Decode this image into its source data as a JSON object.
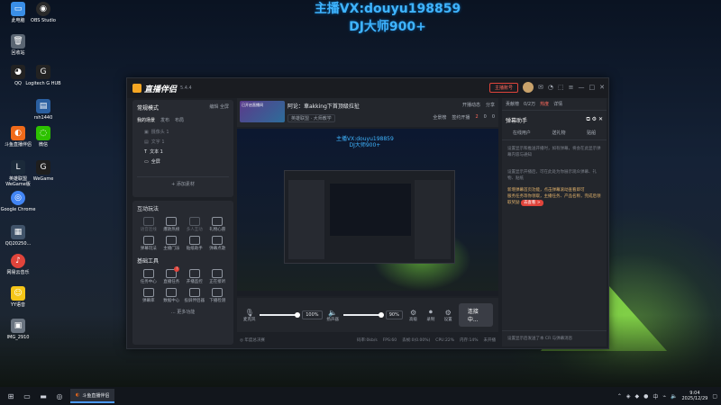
{
  "watermark": {
    "line1": "主播VX:douyu198859",
    "line2": "DJ大师900+"
  },
  "desktop_icons": [
    {
      "label": "此电脑",
      "color": "#3a8ee6"
    },
    {
      "label": "OBS Studio",
      "color": "#2a2a2a"
    },
    {
      "label": "回收站",
      "color": "#5a6572"
    },
    {
      "label": "QQ",
      "color": "#222"
    },
    {
      "label": "Logitech G HUB",
      "color": "#222"
    },
    {
      "label": "rsh1440",
      "color": "#2a5fa0"
    },
    {
      "label": "斗鱼直播伴侣",
      "color": "#f06a1a"
    },
    {
      "label": "微信",
      "color": "#2dc100"
    },
    {
      "label": "英雄联盟 WeGame版",
      "color": "#1b2a3a"
    },
    {
      "label": "WeGame",
      "color": "#1e1e1e"
    },
    {
      "label": "Google Chrome",
      "color": "#4285f4"
    },
    {
      "label": "QQ20250...",
      "color": "#41546a"
    },
    {
      "label": "网易云音乐",
      "color": "#e0443b"
    },
    {
      "label": "YY语音",
      "color": "#f5c518"
    },
    {
      "label": "IMG_2910",
      "color": "#6a7480"
    }
  ],
  "app": {
    "name": "直播伴侣",
    "version": "5.4.4",
    "recording_btn": "主播账号",
    "left": {
      "mode": "常规模式",
      "mode_right1": "编辑",
      "mode_right2": "全屏",
      "tabs": [
        "我的场景",
        "发布",
        "布局"
      ],
      "scenes": [
        "摄像头 1",
        "文字 1",
        "文本 1",
        "全屏"
      ],
      "add_source": "+ 添加素材",
      "interactive_title": "互动玩法",
      "interactive": [
        "语音连线",
        "爆款热榜",
        "多人互动",
        "礼物心愿",
        "弹幕玩法",
        "主播门派",
        "贴纸助手",
        "弹幕点歌"
      ],
      "basic_title": "基础工具",
      "basic": [
        "任务中心",
        "直播任务",
        "开播监控",
        "正在接听",
        "弹幕库",
        "数据中心",
        "投屏伴侣器",
        "下播检测"
      ],
      "more_tools": "… 更多功能"
    },
    "center": {
      "thumb_text": "已开启直播间",
      "room_title": "阿论：車akking下首顶级拉扯",
      "room_cat": "英雄联盟 · 大师教学",
      "share": "开播动态",
      "share2": "分享",
      "row2": [
        "全景榜",
        "签约开播",
        "2",
        "0",
        "0"
      ],
      "preview_wm1": "主播VX:douyu198859",
      "preview_wm2": "DJ大师900+",
      "mic_label": "麦克风",
      "mic_pct": "100%",
      "speaker_label": "扬声器",
      "speaker_pct": "90%",
      "ctrl_labels": [
        "高级",
        "录制",
        "设置"
      ],
      "start_btn": "连接中...",
      "status": [
        "码率:0kb/s",
        "FPS:60",
        "丢帧:0(0.00%)",
        "CPU:22%",
        "内存:14%",
        "未开播"
      ],
      "status_left": "◎ 年度总决赛"
    },
    "right": {
      "tabs": [
        "贡献榜",
        "0/2万",
        "热度",
        "详情"
      ],
      "title": "弹幕助手",
      "subtabs": [
        "在线用户",
        "送礼物",
        "贴船"
      ],
      "text1": "设置显示和推送开播时，如有弹幕，将会在此显示弹幕内容与通知",
      "text2": "设置显示开播后，可在此处为你展示观众弹幕、礼物、贴纸",
      "hl1": "新增弹幕首页功能，点击弹幕滚动查看即可",
      "hl2": "服务任务等你领取，主播任务、产品名称，完成后领取奖励",
      "pill": "去查看 >",
      "footer": "设置显示后发送了本 CR 与弹幕消息"
    }
  },
  "taskbar": {
    "app_label": "斗鱼直播伴侣",
    "time": "9:04",
    "date": "2025/12/29",
    "lang": "中"
  }
}
